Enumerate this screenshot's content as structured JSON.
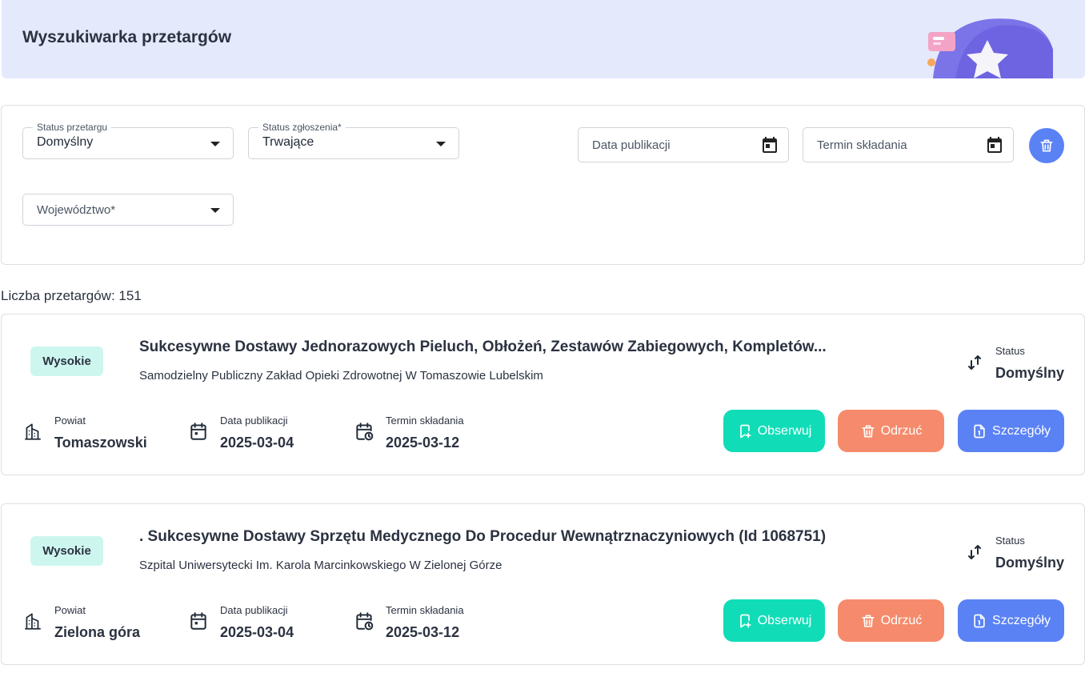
{
  "header": {
    "title": "Wyszukiwarka przetargów"
  },
  "filters": {
    "status_przetargu": {
      "label": "Status przetargu",
      "value": "Domyślny"
    },
    "status_zgloszenia": {
      "label": "Status zgłoszenia*",
      "value": "Trwające"
    },
    "data_publikacji": {
      "placeholder": "Data publikacji"
    },
    "termin_skladania": {
      "placeholder": "Termin składania"
    },
    "wojewodztwo": {
      "placeholder": "Województwo*"
    }
  },
  "results": {
    "count_text": "Liczba przetargów: 151"
  },
  "tenders": [
    {
      "priority": "Wysokie",
      "title": "Sukcesywne Dostawy Jednorazowych Pieluch, Obłożeń, Zestawów Zabiegowych, Kompletów...",
      "institution": "Samodzielny Publiczny Zakład Opieki Zdrowotnej W Tomaszowie Lubelskim",
      "status_label": "Status",
      "status_value": "Domyślny",
      "powiat_label": "Powiat",
      "powiat_value": "Tomaszowski",
      "pub_label": "Data publikacji",
      "pub_value": "2025-03-04",
      "term_label": "Termin składania",
      "term_value": "2025-03-12",
      "btn_observe": "Obserwuj",
      "btn_reject": "Odrzuć",
      "btn_details": "Szczegóły"
    },
    {
      "priority": "Wysokie",
      "title": ". Sukcesywne Dostawy Sprzętu Medycznego Do Procedur Wewnątrznaczyniowych (Id 1068751)",
      "institution": "Szpital Uniwersytecki Im. Karola Marcinkowskiego W Zielonej Górze",
      "status_label": "Status",
      "status_value": "Domyślny",
      "powiat_label": "Powiat",
      "powiat_value": "Zielona góra",
      "pub_label": "Data publikacji",
      "pub_value": "2025-03-04",
      "term_label": "Termin składania",
      "term_value": "2025-03-12",
      "btn_observe": "Obserwuj",
      "btn_reject": "Odrzuć",
      "btn_details": "Szczegóły"
    }
  ],
  "colors": {
    "header_bg": "#e5e9fc",
    "badge_bg": "#cdf6ef",
    "observe": "#10ddb7",
    "reject": "#f58b6c",
    "details": "#5b82f5"
  }
}
